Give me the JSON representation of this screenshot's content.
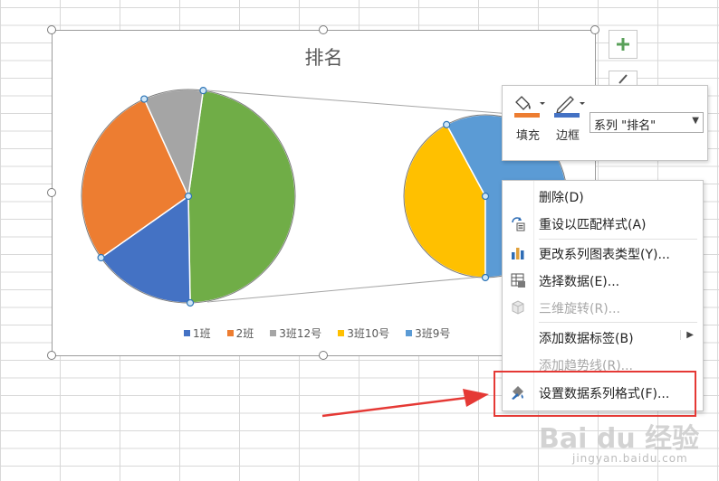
{
  "chart_data": {
    "type": "pie",
    "subtype": "pie-of-pie",
    "title": "排名",
    "categories": [
      "1班",
      "2班",
      "3班12号",
      "3班10号",
      "3班9号"
    ],
    "values": [
      15.5,
      28,
      9,
      20,
      27.5
    ],
    "colors": [
      "#4472c4",
      "#ed7d31",
      "#a5a5a5",
      "#ffc000",
      "#5b9bd5"
    ],
    "other_slice_color": "#70ad47",
    "other_slice_value": 47.5,
    "legend_position": "bottom"
  },
  "chart_title": "排名",
  "legend": [
    {
      "label": "1班",
      "color": "#4472c4"
    },
    {
      "label": "2班",
      "color": "#ed7d31"
    },
    {
      "label": "3班12号",
      "color": "#a5a5a5"
    },
    {
      "label": "3班10号",
      "color": "#ffc000"
    },
    {
      "label": "3班9号",
      "color": "#5b9bd5"
    }
  ],
  "side_buttons": {
    "add_icon": "plus-icon",
    "style_icon": "brush-icon"
  },
  "format_bar": {
    "fill_label": "填充",
    "fill_color": "#ed7d31",
    "border_label": "边框",
    "border_color": "#4472c4",
    "series_select_value": "系列 \"排名\""
  },
  "context_menu": {
    "items": [
      {
        "label": "删除(D)",
        "icon": "none",
        "disabled": false
      },
      {
        "label": "重设以匹配样式(A)",
        "icon": "reset-style-icon",
        "disabled": false
      },
      {
        "label": "更改系列图表类型(Y)...",
        "icon": "change-chart-type-icon",
        "disabled": false
      },
      {
        "label": "选择数据(E)...",
        "icon": "select-data-icon",
        "disabled": false
      },
      {
        "label": "三维旋转(R)...",
        "icon": "3d-rotation-icon",
        "disabled": true
      },
      {
        "label": "添加数据标签(B)",
        "icon": "none",
        "disabled": false,
        "submenu": true
      },
      {
        "label": "添加趋势线(R)...",
        "icon": "none",
        "disabled": true
      },
      {
        "label": "设置数据系列格式(F)...",
        "icon": "format-series-icon",
        "disabled": false
      }
    ]
  },
  "watermark": {
    "brand": "Bai du 经验",
    "sub": "jingyan.baidu.com"
  },
  "colors": {
    "annotation_red": "#e53935"
  }
}
